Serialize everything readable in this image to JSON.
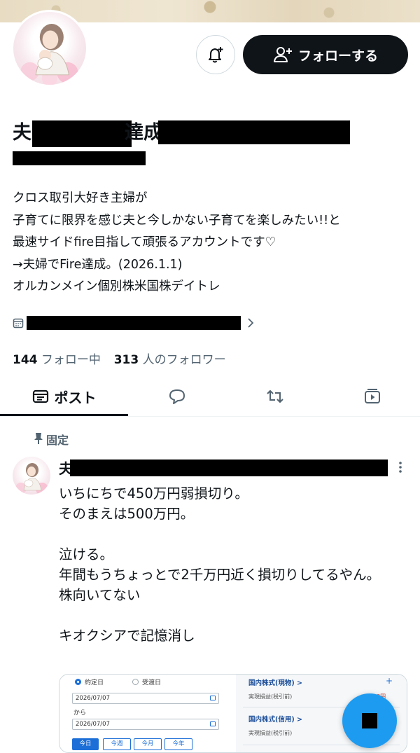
{
  "header": {
    "follow_label": "フォローする"
  },
  "profile": {
    "name_prefix": "夫",
    "name_middle": "達成!",
    "bio": "クロス取引大好き主婦が\n子育てに限界を感じ夫と今しかない子育てを楽しみたい!!と\n最速サイドfire目指して頑張るアカウントです♡\n→夫婦でFire達成。(2026.1.1)\nオルカンメイン個別株米国株デイトレ"
  },
  "stats": {
    "following_count": "144",
    "following_label": "フォロー中",
    "followers_count": "313",
    "followers_label": "人のフォロワー"
  },
  "tabs": {
    "posts_label": "ポスト"
  },
  "pinned_post": {
    "pinned_label": "固定",
    "author_initial": "夫",
    "text": "いちにちで450万円弱損切り。\nそのまえは500万円。\n\n泣ける。\n年間もうちょっとで2千万円近く損切りしてるやん。\n株向いてない\n\nキオクシアで記憶消し",
    "attachment": {
      "radio_contract": "約定日",
      "radio_delivery": "受渡日",
      "date_from": "2026/07/07",
      "date_sep": "から",
      "date_to": "2026/07/07",
      "period_buttons": [
        "今日",
        "今週",
        "今月",
        "今年"
      ],
      "domestic_spot": "国内株式(現物) >",
      "domestic_spot_sub": "実現損益(税引前)",
      "domestic_spot_value": "93円",
      "domestic_margin": "国内株式(信用) >",
      "domestic_margin_sub": "実現損益(税引前)",
      "plus_sign": "+"
    }
  },
  "icons": {
    "bell": "bell-plus-icon",
    "follow": "person-plus-icon",
    "calendar": "calendar-icon",
    "chevron": "chevron-right-icon",
    "pin": "pin-icon",
    "more": "more-vertical-icon",
    "fab": "compose-icon"
  },
  "colors": {
    "primary_text": "#0f1419",
    "secondary_text": "#536471",
    "accent_blue": "#1d9bf0",
    "button_dark": "#0f1419"
  }
}
